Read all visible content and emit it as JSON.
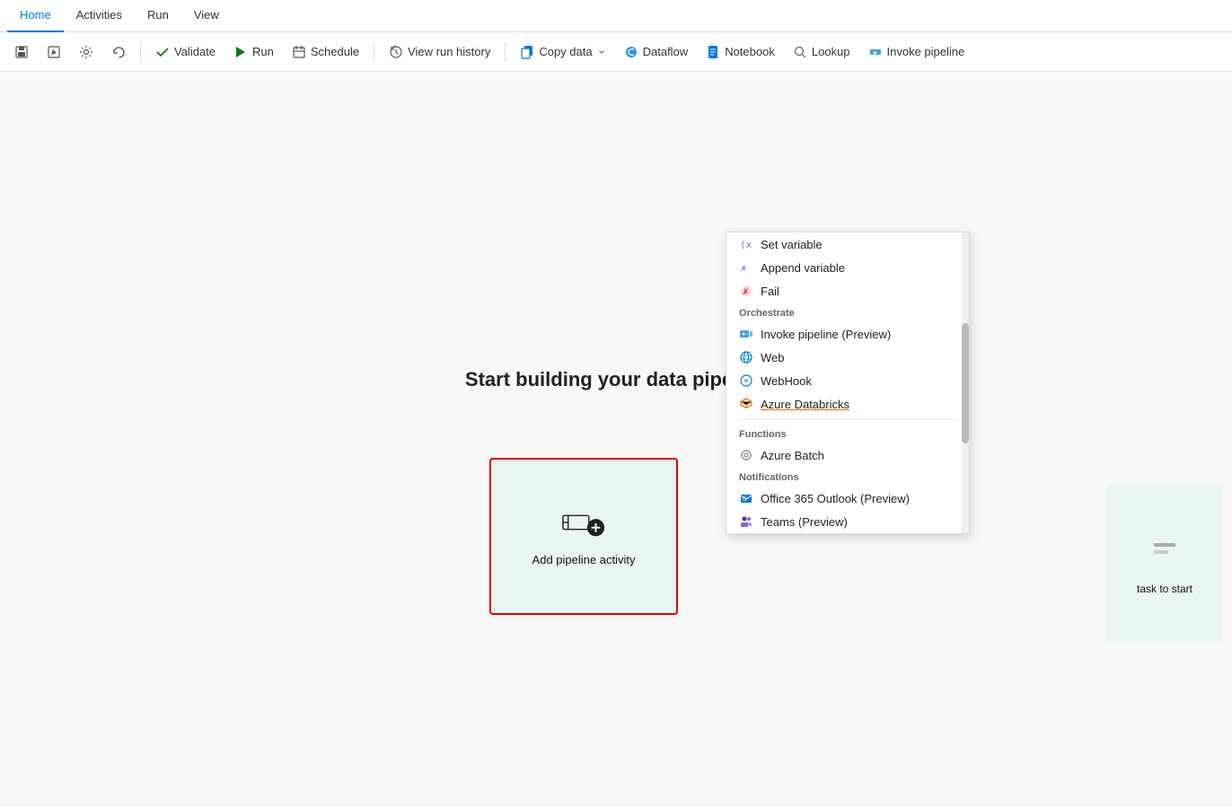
{
  "tabs": [
    {
      "id": "home",
      "label": "Home",
      "active": true
    },
    {
      "id": "activities",
      "label": "Activities",
      "active": false
    },
    {
      "id": "run",
      "label": "Run",
      "active": false
    },
    {
      "id": "view",
      "label": "View",
      "active": false
    }
  ],
  "toolbar": {
    "save_label": "💾",
    "validate_label": "Validate",
    "run_label": "Run",
    "schedule_label": "Schedule",
    "view_run_history_label": "View run history",
    "copy_data_label": "Copy data",
    "dataflow_label": "Dataflow",
    "notebook_label": "Notebook",
    "lookup_label": "Lookup",
    "invoke_pipeline_label": "Invoke pipeline"
  },
  "canvas": {
    "title": "Start building your data pipeline",
    "add_activity_label": "Add pipeline activity",
    "right_card_label": "task to start"
  },
  "dropdown": {
    "items": [
      {
        "id": "set-variable",
        "label": "Set variable",
        "icon_color": "#8b5cf6",
        "icon_type": "xy",
        "section": null
      },
      {
        "id": "append-variable",
        "label": "Append variable",
        "icon_color": "#8b5cf6",
        "icon_type": "x",
        "section": null
      },
      {
        "id": "fail",
        "label": "Fail",
        "icon_color": "#e00",
        "icon_type": "x-red",
        "section": null
      },
      {
        "id": "orchestrate-header",
        "label": "Orchestrate",
        "type": "section"
      },
      {
        "id": "invoke-pipeline",
        "label": "Invoke pipeline (Preview)",
        "icon_color": "#0078d4",
        "icon_type": "pipeline"
      },
      {
        "id": "web",
        "label": "Web",
        "icon_color": "#0078d4",
        "icon_type": "globe"
      },
      {
        "id": "webhook",
        "label": "WebHook",
        "icon_color": "#0078d4",
        "icon_type": "webhook"
      },
      {
        "id": "azure-databricks",
        "label": "Azure Databricks",
        "icon_color": "#e86c00",
        "icon_type": "layers",
        "underline": true
      },
      {
        "id": "functions-header",
        "label": "Functions",
        "type": "section_divider_above"
      },
      {
        "id": "azure-batch",
        "label": "Azure Batch",
        "icon_color": "#888",
        "icon_type": "gear"
      },
      {
        "id": "notifications-header",
        "label": "Notifications",
        "type": "section"
      },
      {
        "id": "office365",
        "label": "Office 365 Outlook (Preview)",
        "icon_color": "#0078d4",
        "icon_type": "office"
      },
      {
        "id": "teams",
        "label": "Teams (Preview)",
        "icon_color": "#5c2d91",
        "icon_type": "teams"
      }
    ]
  }
}
